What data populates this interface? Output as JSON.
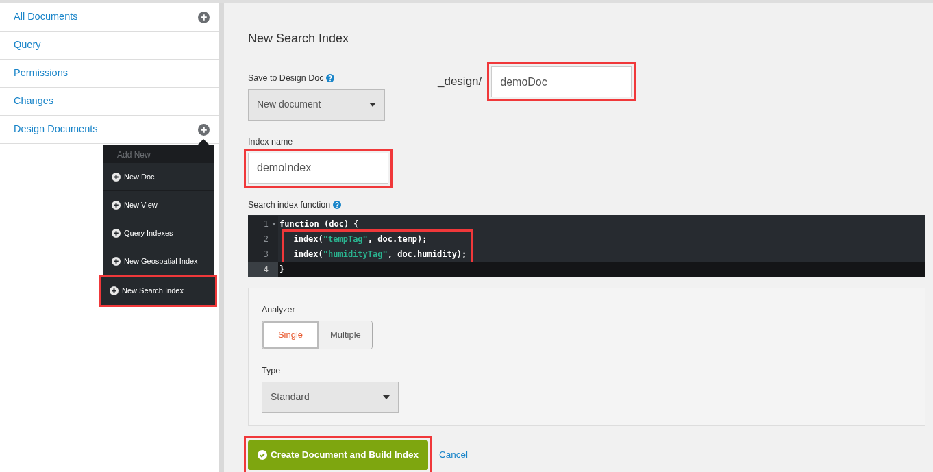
{
  "sidebar": {
    "items": [
      {
        "label": "All Documents",
        "has_add": true
      },
      {
        "label": "Query",
        "has_add": false
      },
      {
        "label": "Permissions",
        "has_add": false
      },
      {
        "label": "Changes",
        "has_add": false
      },
      {
        "label": "Design Documents",
        "has_add": true
      }
    ]
  },
  "add_menu": {
    "header": "Add New",
    "items": [
      {
        "label": "New Doc",
        "highlighted": false
      },
      {
        "label": "New View",
        "highlighted": false
      },
      {
        "label": "Query Indexes",
        "highlighted": false
      },
      {
        "label": "New Geospatial Index",
        "highlighted": false
      },
      {
        "label": "New Search Index",
        "highlighted": true
      }
    ]
  },
  "form": {
    "title": "New Search Index",
    "design_doc": {
      "label": "Save to Design Doc",
      "value": "New document"
    },
    "design_prefix": "_design/",
    "design_name": {
      "value": "demoDoc",
      "highlighted": true
    },
    "index_name": {
      "label": "Index name",
      "value": "demoIndex",
      "highlighted": true
    },
    "function_label": "Search index function",
    "code": [
      {
        "number": "1",
        "foldable": true,
        "active": false,
        "highlighted": false,
        "tokens": [
          {
            "kind": "plain",
            "text": "function (doc) {"
          }
        ]
      },
      {
        "number": "2",
        "foldable": false,
        "active": false,
        "highlighted": true,
        "tokens": [
          {
            "kind": "plain",
            "text": "  index("
          },
          {
            "kind": "string",
            "text": "\"tempTag\""
          },
          {
            "kind": "plain",
            "text": ", doc.temp);"
          }
        ]
      },
      {
        "number": "3",
        "foldable": false,
        "active": false,
        "highlighted": true,
        "tokens": [
          {
            "kind": "plain",
            "text": "  index("
          },
          {
            "kind": "string",
            "text": "\"humidityTag\""
          },
          {
            "kind": "plain",
            "text": ", doc.humidity);"
          }
        ]
      },
      {
        "number": "4",
        "foldable": false,
        "active": true,
        "highlighted": false,
        "tokens": [
          {
            "kind": "plain",
            "text": "}"
          }
        ]
      }
    ],
    "analyzer": {
      "label": "Analyzer",
      "options": [
        {
          "label": "Single",
          "selected": true
        },
        {
          "label": "Multiple",
          "selected": false
        }
      ]
    },
    "type": {
      "label": "Type",
      "value": "Standard"
    },
    "submit": {
      "label": "Create Document and Build Index",
      "highlighted": true
    },
    "cancel": "Cancel"
  }
}
